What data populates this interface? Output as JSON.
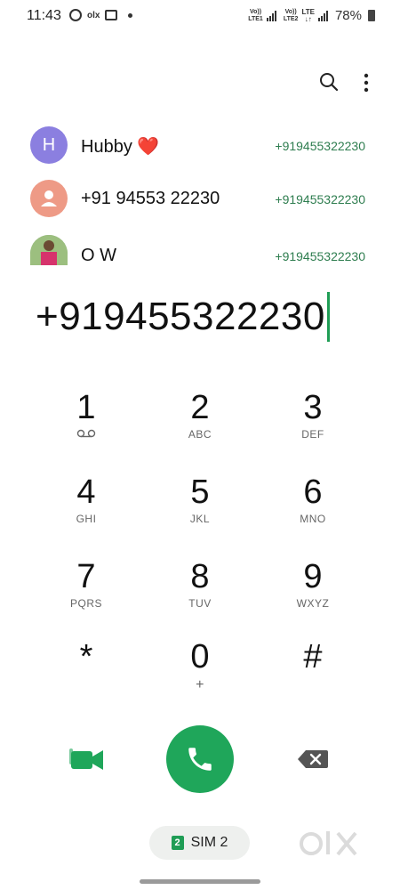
{
  "status_bar": {
    "time": "11:43",
    "sim1_label_top": "Vo))",
    "sim1_label_bottom": "LTE1",
    "sim2_label_top": "Vo))",
    "sim2_label_bottom": "LTE2",
    "sim2_network": "LTE",
    "battery": "78%"
  },
  "header": {
    "search_icon": "search-icon",
    "menu_icon": "more-vert-icon"
  },
  "suggestions": [
    {
      "initial": "H",
      "name": "Hubby ❤️",
      "number": "+919455322230",
      "avatar_color": "#8b7fe0"
    },
    {
      "initial": "",
      "name": "+91 94553 22230",
      "number": "+919455322230",
      "avatar_color": "#ee9a86"
    },
    {
      "initial": "",
      "name": "O W",
      "number": "+919455322230",
      "avatar_color": "#7aa56a"
    }
  ],
  "dialed_number": "+919455322230",
  "keypad": [
    {
      "digit": "1",
      "letters": ""
    },
    {
      "digit": "2",
      "letters": "ABC"
    },
    {
      "digit": "3",
      "letters": "DEF"
    },
    {
      "digit": "4",
      "letters": "GHI"
    },
    {
      "digit": "5",
      "letters": "JKL"
    },
    {
      "digit": "6",
      "letters": "MNO"
    },
    {
      "digit": "7",
      "letters": "PQRS"
    },
    {
      "digit": "8",
      "letters": "TUV"
    },
    {
      "digit": "9",
      "letters": "WXYZ"
    },
    {
      "digit": "*",
      "letters": ""
    },
    {
      "digit": "0",
      "letters": "+"
    },
    {
      "digit": "#",
      "letters": ""
    }
  ],
  "actions": {
    "video_call_icon": "video-call-icon",
    "call_icon": "phone-icon",
    "backspace_icon": "backspace-icon"
  },
  "sim_selector": {
    "badge": "2",
    "label": "SIM 2"
  },
  "colors": {
    "accent_green": "#1fa65a",
    "number_green": "#2e7d4f"
  }
}
